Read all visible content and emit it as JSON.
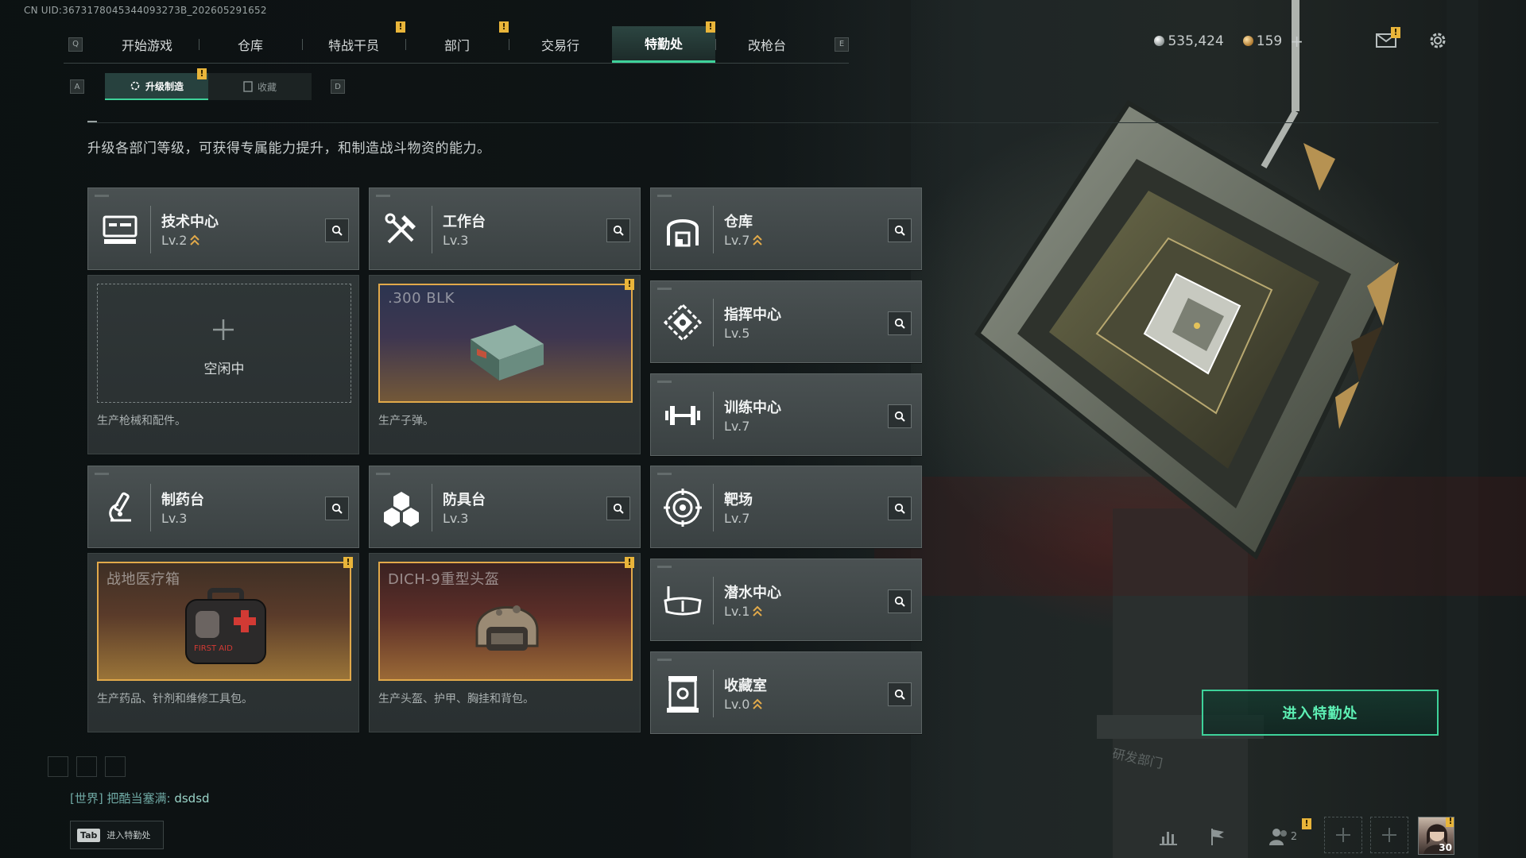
{
  "uid": "CN UID:3673178045344093273B_202605291652",
  "main_nav": {
    "left_key": "Q",
    "right_key": "E",
    "tabs": [
      {
        "label": "开始游戏",
        "active": false,
        "badge": ""
      },
      {
        "label": "仓库",
        "active": false,
        "badge": ""
      },
      {
        "label": "特战干员",
        "active": false,
        "badge": "!"
      },
      {
        "label": "部门",
        "active": false,
        "badge": "!"
      },
      {
        "label": "交易行",
        "active": false,
        "badge": ""
      },
      {
        "label": "特勤处",
        "active": true,
        "badge": "!"
      },
      {
        "label": "改枪台",
        "active": false,
        "badge": ""
      }
    ]
  },
  "currency": {
    "silver": "535,424",
    "gold": "159",
    "add": "+"
  },
  "mail_badge": "!",
  "sub_nav": {
    "left_key": "A",
    "right_key": "D",
    "tabs": [
      {
        "label": "升级制造",
        "active": true,
        "badge": "!"
      },
      {
        "label": "收藏",
        "active": false,
        "badge": ""
      }
    ]
  },
  "description": "升级各部门等级，可获得专属能力提升，和制造战斗物资的能力。",
  "departments": {
    "tech": {
      "name": "技术中心",
      "level": "Lv.2",
      "upgradable": true
    },
    "workbench": {
      "name": "工作台",
      "level": "Lv.3",
      "upgradable": false
    },
    "warehouse": {
      "name": "仓库",
      "level": "Lv.7",
      "upgradable": true
    },
    "command": {
      "name": "指挥中心",
      "level": "Lv.5",
      "upgradable": false
    },
    "training": {
      "name": "训练中心",
      "level": "Lv.7",
      "upgradable": false
    },
    "pharmacy": {
      "name": "制药台",
      "level": "Lv.3",
      "upgradable": false
    },
    "armor": {
      "name": "防具台",
      "level": "Lv.3",
      "upgradable": false
    },
    "range": {
      "name": "靶场",
      "level": "Lv.7",
      "upgradable": false
    },
    "diving": {
      "name": "潜水中心",
      "level": "Lv.1",
      "upgradable": true
    },
    "collection": {
      "name": "收藏室",
      "level": "Lv.0",
      "upgradable": true
    }
  },
  "production": {
    "tech": {
      "slot_label": "空闲中",
      "caption": "生产枪械和配件。"
    },
    "workbench": {
      "item": ".300 BLK",
      "caption": "生产子弹。",
      "badge": "!"
    },
    "pharmacy": {
      "item": "战地医疗箱",
      "caption": "生产药品、针剂和维修工具包。",
      "badge": "!",
      "kit_text": "FIRST AID"
    },
    "armor": {
      "item": "DICH-9重型头盔",
      "caption": "生产头盔、护甲、胸挂和背包。",
      "badge": "!"
    }
  },
  "enter_button": "进入特勤处",
  "scene_sign": "研发部门",
  "chat": {
    "channel": "[世界]",
    "user": "把酷当塞满:",
    "message": "dsdsd"
  },
  "tab_hint": {
    "key": "Tab",
    "label": "进入特勤处"
  },
  "bottom_bar": {
    "friends_count": "2",
    "friends_badge": "!",
    "avatar_badge": "!",
    "avatar_level": "30"
  },
  "colors": {
    "accent": "#3ed29a",
    "badge": "#e9b53a",
    "item_border": "#e1a94a"
  },
  "icons": [
    "search-icon",
    "tech-center-icon",
    "workbench-icon",
    "warehouse-icon",
    "command-center-icon",
    "training-center-icon",
    "pharmacy-icon",
    "armor-bench-icon",
    "range-icon",
    "diving-center-icon",
    "collection-room-icon",
    "mail-icon",
    "gear-icon",
    "stats-icon",
    "flag-icon",
    "friends-icon",
    "plus-icon",
    "upgrade-arrow-icon"
  ]
}
